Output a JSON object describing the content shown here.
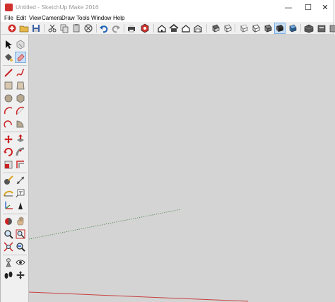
{
  "window": {
    "title": "Untitled - SketchUp Make 2016",
    "minimize_glyph": "—",
    "maximize_glyph": "☐",
    "close_glyph": "✕"
  },
  "menu": [
    "File",
    "Edit",
    "View",
    "Camera",
    "Draw",
    "Tools",
    "Window",
    "Help"
  ],
  "toolbar_icons": [
    "getting-started-icon",
    "open-icon",
    "save-icon",
    "cut-icon",
    "copy-icon",
    "paste-icon",
    "erase-icon",
    "undo-icon",
    "redo-icon",
    "print-icon",
    "model-info-icon",
    "iso-view-icon",
    "top-view-icon",
    "front-view-icon",
    "right-view-icon",
    "back-view-icon",
    "left-view-icon",
    "xray-icon",
    "back-edges-icon",
    "wireframe-icon",
    "hidden-line-icon",
    "shaded-icon",
    "shaded-textures-icon",
    "monochrome-icon",
    "warehouse-icon",
    "extension-icon"
  ],
  "left_tools": [
    [
      "select-icon",
      "component-icon"
    ],
    [
      "paint-bucket-icon",
      "eraser-icon"
    ],
    [
      "line-icon",
      "freehand-icon"
    ],
    [
      "rectangle-icon",
      "rotated-rectangle-icon"
    ],
    [
      "circle-icon",
      "polygon-icon"
    ],
    [
      "arc-icon",
      "two-point-arc-icon"
    ],
    [
      "three-point-arc-icon",
      "pie-icon"
    ],
    [
      "move-icon",
      "push-pull-icon"
    ],
    [
      "rotate-icon",
      "follow-me-icon"
    ],
    [
      "scale-icon",
      "offset-icon"
    ],
    [
      "tape-measure-icon",
      "dimension-icon"
    ],
    [
      "protractor-icon",
      "text-icon"
    ],
    [
      "axes-icon",
      "3d-text-icon"
    ],
    [
      "orbit-icon",
      "pan-icon"
    ],
    [
      "zoom-icon",
      "zoom-window-icon"
    ],
    [
      "zoom-extents-icon",
      "previous-icon"
    ],
    [
      "position-camera-icon",
      "look-around-icon"
    ],
    [
      "walk-icon",
      "section-plane-icon"
    ]
  ],
  "colors": {
    "canvas": "#d4d4d4",
    "red_axis": "#c84040",
    "green_axis": "#3a7a3a",
    "accent": "#c9dff5"
  }
}
